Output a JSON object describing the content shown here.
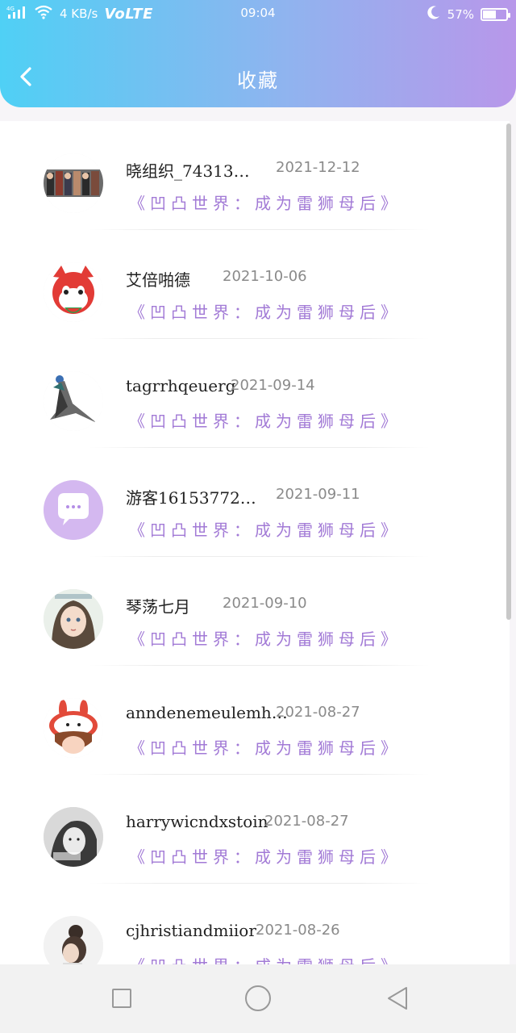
{
  "status_bar": {
    "network": "4G",
    "speed": "4 KB/s",
    "volte": "VoLTE",
    "time": "09:04",
    "battery": "57%",
    "battery_level": 0.57
  },
  "header": {
    "title": "收藏"
  },
  "list": [
    {
      "name": "晓组织_74313…",
      "date": "2021-12-12",
      "book": "《凹凸世界：成为雷狮母后》",
      "avatar_icon": "group-photo-avatar"
    },
    {
      "name": "艾倍啪德",
      "date": "2021-10-06",
      "book": "《凹凸世界：成为雷狮母后》",
      "avatar_icon": "red-fox-avatar"
    },
    {
      "name": "tagrrhqeuerg",
      "date": "2021-09-14",
      "book": "《凹凸世界：成为雷狮母后》",
      "avatar_icon": "ink-figure-avatar"
    },
    {
      "name": "游客16153772…",
      "date": "2021-09-11",
      "book": "《凹凸世界：成为雷狮母后》",
      "avatar_icon": "chat-bubble-avatar"
    },
    {
      "name": "琴荡七月",
      "date": "2021-09-10",
      "book": "《凹凸世界：成为雷狮母后》",
      "avatar_icon": "anime-girl-avatar"
    },
    {
      "name": "anndenemeulemh…",
      "date": "2021-08-27",
      "book": "《凹凸世界：成为雷狮母后》",
      "avatar_icon": "bunny-doll-avatar"
    },
    {
      "name": "harrywicndxstoin",
      "date": "2021-08-27",
      "book": "《凹凸世界：成为雷狮母后》",
      "avatar_icon": "bw-portrait-avatar"
    },
    {
      "name": "cjhristiandmiior",
      "date": "2021-08-26",
      "book": "《凹凸世界：成为雷狮母后》",
      "avatar_icon": "hair-bun-avatar"
    }
  ],
  "colors": {
    "header_start": "#4fd0f5",
    "header_end": "#b897ea",
    "book_title": "#a27ad6"
  }
}
